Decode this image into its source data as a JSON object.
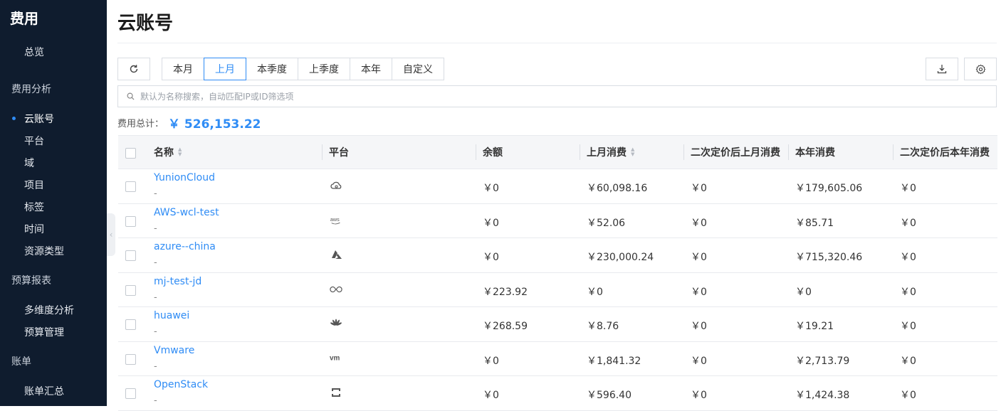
{
  "sidebar": {
    "title": "费用",
    "items": {
      "overview": "总览",
      "cost_analysis_group": "费用分析",
      "cloud_account": "云账号",
      "platform": "平台",
      "domain": "域",
      "project": "项目",
      "tag": "标签",
      "time": "时间",
      "resource_type": "资源类型",
      "budget_report_group": "预算报表",
      "multi_dim": "多维度分析",
      "budget_mgmt": "预算管理",
      "bill_group": "账单",
      "bill_summary": "账单汇总"
    },
    "active_item": "云账号"
  },
  "page": {
    "title": "云账号"
  },
  "toolbar": {
    "refresh_icon": "refresh-icon",
    "periods": [
      "本月",
      "上月",
      "本季度",
      "上季度",
      "本年",
      "自定义"
    ],
    "active_period": "上月",
    "download_icon": "download-icon",
    "settings_icon": "gear-icon"
  },
  "search": {
    "placeholder": "默认为名称搜索，自动匹配IP或ID筛选项"
  },
  "total": {
    "label": "费用总计：",
    "value": "￥ 526,153.22"
  },
  "table": {
    "columns": [
      "名称",
      "平台",
      "余额",
      "上月消费",
      "二次定价后上月消费",
      "本年消费",
      "二次定价后本年消费"
    ],
    "rows": [
      {
        "name": "YunionCloud",
        "sub": "-",
        "platform_icon": "yunion-cloud-icon",
        "balance": "￥0",
        "last_month": "￥60,098.16",
        "last_month_repriced": "￥0",
        "this_year": "￥179,605.06",
        "this_year_repriced": "￥0"
      },
      {
        "name": "AWS-wcl-test",
        "sub": "-",
        "platform_icon": "aws-icon",
        "balance": "￥0",
        "last_month": "￥52.06",
        "last_month_repriced": "￥0",
        "this_year": "￥85.71",
        "this_year_repriced": "￥0"
      },
      {
        "name": "azure--china",
        "sub": "-",
        "platform_icon": "azure-icon",
        "balance": "￥0",
        "last_month": "￥230,000.24",
        "last_month_repriced": "￥0",
        "this_year": "￥715,320.46",
        "this_year_repriced": "￥0"
      },
      {
        "name": "mj-test-jd",
        "sub": "-",
        "platform_icon": "jd-cloud-icon",
        "balance": "￥223.92",
        "last_month": "￥0",
        "last_month_repriced": "￥0",
        "this_year": "￥0",
        "this_year_repriced": "￥0"
      },
      {
        "name": "huawei",
        "sub": "-",
        "platform_icon": "huawei-icon",
        "balance": "￥268.59",
        "last_month": "￥8.76",
        "last_month_repriced": "￥0",
        "this_year": "￥19.21",
        "this_year_repriced": "￥0"
      },
      {
        "name": "Vmware",
        "sub": "-",
        "platform_icon": "vmware-icon",
        "balance": "￥0",
        "last_month": "￥1,841.32",
        "last_month_repriced": "￥0",
        "this_year": "￥2,713.79",
        "this_year_repriced": "￥0"
      },
      {
        "name": "OpenStack",
        "sub": "-",
        "platform_icon": "openstack-icon",
        "balance": "￥0",
        "last_month": "￥596.40",
        "last_month_repriced": "￥0",
        "this_year": "￥1,424.38",
        "this_year_repriced": "￥0"
      }
    ]
  },
  "colors": {
    "sidebar_bg": "#0f1c2e",
    "accent": "#2f8cf5",
    "link": "#2f8cf5"
  }
}
